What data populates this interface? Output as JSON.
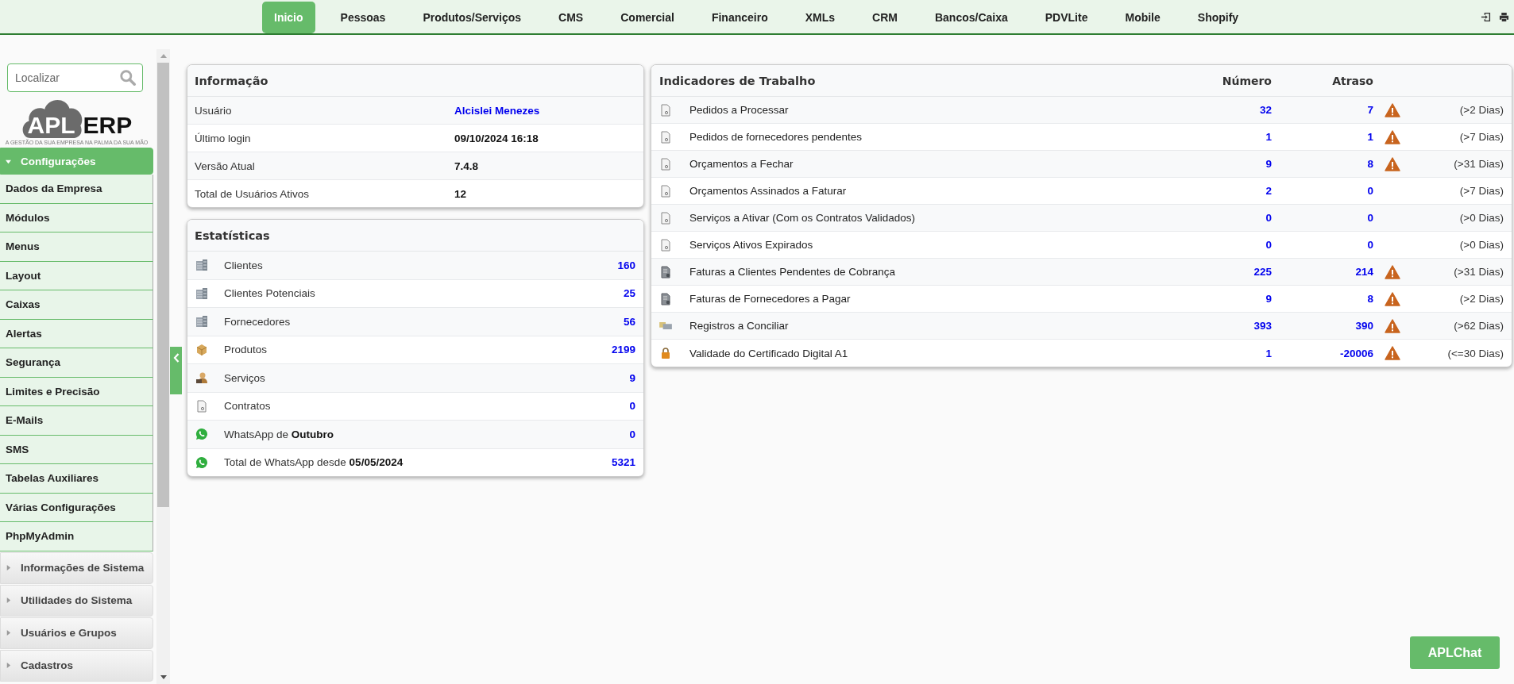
{
  "nav": {
    "tabs": [
      {
        "label": "Inicio",
        "selected": true
      },
      {
        "label": "Pessoas",
        "selected": false
      },
      {
        "label": "Produtos/Serviços",
        "selected": false
      },
      {
        "label": "CMS",
        "selected": false
      },
      {
        "label": "Comercial",
        "selected": false
      },
      {
        "label": "Financeiro",
        "selected": false
      },
      {
        "label": "XMLs",
        "selected": false
      },
      {
        "label": "CRM",
        "selected": false
      },
      {
        "label": "Bancos/Caixa",
        "selected": false
      },
      {
        "label": "PDVLite",
        "selected": false
      },
      {
        "label": "Mobile",
        "selected": false
      },
      {
        "label": "Shopify",
        "selected": false
      }
    ]
  },
  "sidebar": {
    "search": {
      "placeholder": "Localizar"
    },
    "logo": {
      "left": "APL",
      "right": "ERP",
      "tagline": "A GESTÃO DA SUA EMPRESA NA PALMA DA SUA MÃO"
    },
    "groups": [
      {
        "label": "Configurações",
        "expanded": true,
        "items": [
          "Dados da Empresa",
          "Módulos",
          "Menus",
          "Layout",
          "Caixas",
          "Alertas",
          "Segurança",
          "Limites e Precisão",
          "E-Mails",
          "SMS",
          "Tabelas Auxiliares",
          "Várias Configurações",
          "PhpMyAdmin"
        ]
      },
      {
        "label": "Informações de Sistema",
        "expanded": false
      },
      {
        "label": "Utilidades do Sistema",
        "expanded": false
      },
      {
        "label": "Usuários e Grupos",
        "expanded": false
      },
      {
        "label": "Cadastros",
        "expanded": false
      }
    ]
  },
  "info": {
    "title": "Informação",
    "rows": [
      {
        "label": "Usuário",
        "value": "Alcislei Menezes",
        "kind": "link"
      },
      {
        "label": "Último login",
        "value": "09/10/2024 16:18",
        "kind": "plain"
      },
      {
        "label": "Versão Atual",
        "value": "7.4.8",
        "kind": "plain"
      },
      {
        "label": "Total de Usuários Ativos",
        "value": "12",
        "kind": "plain"
      }
    ]
  },
  "stats": {
    "title": "Estatísticas",
    "rows": [
      {
        "kind": "building",
        "label": "Clientes",
        "value": "160"
      },
      {
        "kind": "building",
        "label": "Clientes Potenciais",
        "value": "25"
      },
      {
        "kind": "building",
        "label": "Fornecedores",
        "value": "56"
      },
      {
        "kind": "box",
        "label": "Produtos",
        "value": "2199"
      },
      {
        "kind": "service",
        "label": "Serviços",
        "value": "9"
      },
      {
        "kind": "document",
        "label": "Contratos",
        "value": "0"
      },
      {
        "kind": "whatsapp",
        "label": "WhatsApp de **Outubro**",
        "value": "0"
      },
      {
        "kind": "whatsapp",
        "label": "Total de WhatsApp desde **05/05/2024**",
        "value": "5321"
      }
    ]
  },
  "indicators": {
    "title": "Indicadores de Trabalho",
    "columns": [
      "Número",
      "Atraso"
    ],
    "rows": [
      {
        "kind": "document",
        "label": "Pedidos a Processar",
        "number": "32",
        "delay": "7",
        "warning": true,
        "period": "(>2 Dias)"
      },
      {
        "kind": "document",
        "label": "Pedidos de fornecedores pendentes",
        "number": "1",
        "delay": "1",
        "warning": true,
        "period": "(>7 Dias)"
      },
      {
        "kind": "document",
        "label": "Orçamentos a Fechar",
        "number": "9",
        "delay": "8",
        "warning": true,
        "period": "(>31 Dias)"
      },
      {
        "kind": "document",
        "label": "Orçamentos Assinados a Faturar",
        "number": "2",
        "delay": "0",
        "warning": false,
        "period": "(>7 Dias)"
      },
      {
        "kind": "document",
        "label": "Serviços a Ativar (Com os Contratos Validados)",
        "number": "0",
        "delay": "0",
        "warning": false,
        "period": "(>0 Dias)"
      },
      {
        "kind": "document",
        "label": "Serviços Ativos Expirados",
        "number": "0",
        "delay": "0",
        "warning": false,
        "period": "(>0 Dias)"
      },
      {
        "kind": "invoice",
        "label": "Faturas a Clientes Pendentes de Cobrança",
        "number": "225",
        "delay": "214",
        "warning": true,
        "period": "(>31 Dias)"
      },
      {
        "kind": "invoice",
        "label": "Faturas de Fornecedores a Pagar",
        "number": "9",
        "delay": "8",
        "warning": true,
        "period": "(>2 Dias)"
      },
      {
        "kind": "bank",
        "label": "Registros a Conciliar",
        "number": "393",
        "delay": "390",
        "warning": true,
        "period": "(>62 Dias)"
      },
      {
        "kind": "lock",
        "label": "Validade do Certificado Digital A1",
        "number": "1",
        "delay": "-20006",
        "warning": true,
        "period": "(<=30 Dias)"
      }
    ]
  },
  "chat_button": "APLChat"
}
